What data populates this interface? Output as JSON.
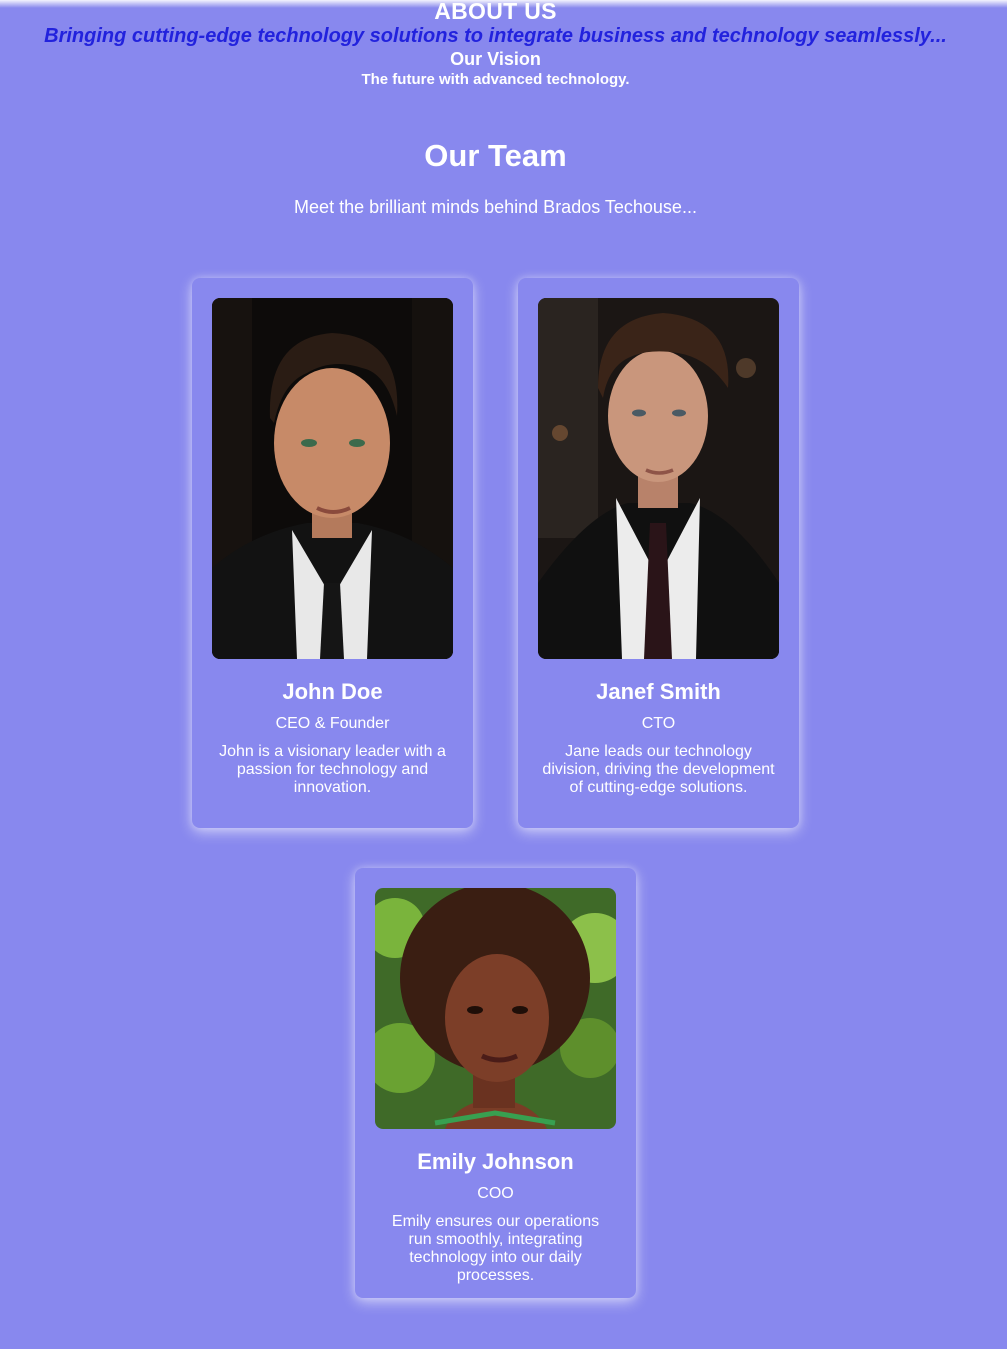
{
  "about": {
    "title": "ABOUT US",
    "tagline": "Bringing cutting-edge technology solutions to integrate business and technology seamlessly...",
    "vision_title": "Our Vision",
    "vision_text": "The future with advanced technology."
  },
  "team": {
    "title": "Our Team",
    "subtitle": "Meet the brilliant minds behind Brados Techouse...",
    "members": [
      {
        "name": "John Doe",
        "role": "CEO & Founder",
        "bio": "John is a visionary leader with a passion for technology and innovation."
      },
      {
        "name": "Janef Smith",
        "role": "CTO",
        "bio": "Jane leads our technology division, driving the development of cutting-edge solutions."
      },
      {
        "name": "Emily Johnson",
        "role": "COO",
        "bio": "Emily ensures our operations run smoothly, integrating technology into our daily processes."
      }
    ]
  },
  "colors": {
    "background": "#8888ee",
    "tagline": "#2222dd",
    "text": "#ffffff"
  }
}
